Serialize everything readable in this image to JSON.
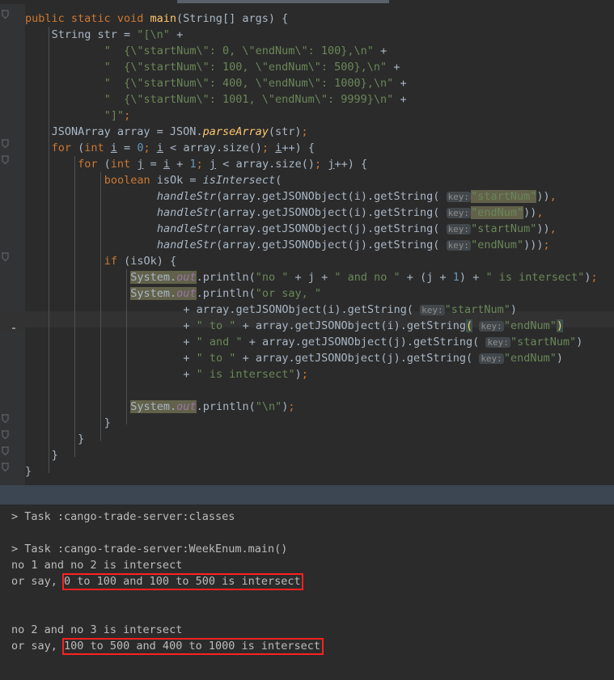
{
  "theme": {
    "editor_bg": "#2b2b2b",
    "gutter_bg": "#313335",
    "current_line_bg": "#323232",
    "divider_bar": "#3c4552",
    "console_bg": "#2b2b2b",
    "console_text": "#bbbbbb",
    "keyword": "#cc7832",
    "string": "#6a8759",
    "number": "#6897bb",
    "method": "#ffc66d",
    "field": "#9876aa",
    "identifier_text": "#a9b7c6",
    "inlay_hint_bg": "#42474b",
    "inlay_hint_text": "#8c8c8c",
    "selection_bg": "#62614a",
    "brace_match_bg": "#3b514d",
    "annotation_red": "#ff2020",
    "scrollbar_thumb": "#5a6169"
  },
  "editor": {
    "language": "java",
    "inlay_label": "key:",
    "gutter": {
      "bulb_icon": "lightbulb-icon",
      "bulb_line": 20,
      "fold_icon": "fold-arrow-icon",
      "fold_lines": [
        1,
        9,
        10,
        16,
        26,
        27,
        28,
        29
      ]
    },
    "current_line": 20,
    "lines": [
      "public static void main(String[] args) {",
      "    String str = \"[\\n\" +",
      "            \"  {\\\"startNum\\\": 0, \\\"endNum\\\": 100},\\n\" +",
      "            \"  {\\\"startNum\\\": 100, \\\"endNum\\\": 500},\\n\" +",
      "            \"  {\\\"startNum\\\": 400, \\\"endNum\\\": 1000},\\n\" +",
      "            \"  {\\\"startNum\\\": 1001, \\\"endNum\\\": 9999}\\n\" +",
      "            \"]\";",
      "    JSONArray array = JSON.parseArray(str);",
      "    for (int i = 0; i < array.size(); i++) {",
      "        for (int j = i + 1; j < array.size(); j++) {",
      "            boolean isOk = isIntersect(",
      "                    handleStr(array.getJSONObject(i).getString( key: \"startNum\")),",
      "                    handleStr(array.getJSONObject(i).getString( key: \"endNum\")),",
      "                    handleStr(array.getJSONObject(j).getString( key: \"startNum\")),",
      "                    handleStr(array.getJSONObject(j).getString( key: \"endNum\")));",
      "            if (isOk) {",
      "                System.out.println(\"no \" + j + \" and no \" + (j + 1) + \" is intersect\");",
      "                System.out.println(\"or say, \"",
      "                        + array.getJSONObject(i).getString( key: \"startNum\")",
      "                        + \" to \" + array.getJSONObject(i).getString( key: \"endNum\")",
      "                        + \" and \" + array.getJSONObject(j).getString( key: \"startNum\")",
      "                        + \" to \" + array.getJSONObject(j).getString( key: \"endNum\")",
      "                        + \" is intersect\");",
      "",
      "                System.out.println(\"\\n\");",
      "            }",
      "        }",
      "    }",
      "}"
    ]
  },
  "console": {
    "lines": [
      "> Task :cango-trade-server:classes",
      "",
      "> Task :cango-trade-server:WeekEnum.main()",
      "no 1 and no 2 is intersect",
      "or say, 0 to 100 and 100 to 500 is intersect",
      "",
      "",
      "no 2 and no 3 is intersect",
      "or say, 100 to 500 and 400 to 1000 is intersect"
    ],
    "annotations": [
      {
        "text": "0 to 100 and 100 to 500 is intersect",
        "line": 4
      },
      {
        "text": "100 to 500 and 400 to 1000 is intersect",
        "line": 8
      }
    ]
  }
}
